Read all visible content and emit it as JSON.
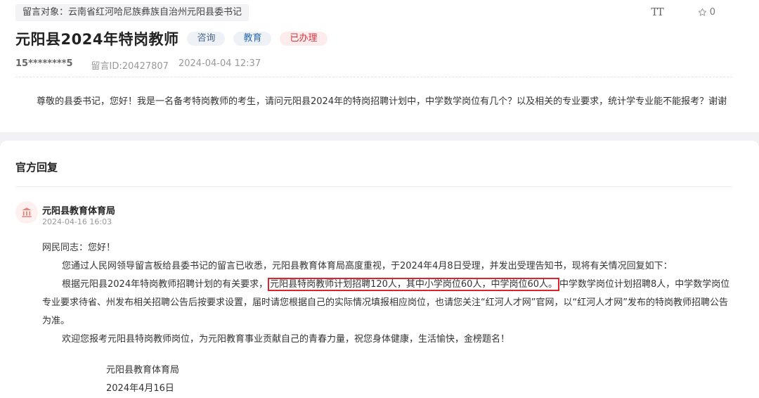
{
  "message": {
    "target": "留言对象：云南省红河哈尼族彝族自治州元阳县委书记",
    "title": "元阳县2024年特岗教师",
    "tags": [
      "咨询",
      "教育",
      "已办理"
    ],
    "user": "15********5",
    "message_id": "留言ID:20427807",
    "datetime": "2024-04-04 12:37",
    "star_count": "0",
    "question": "尊敬的县委书记，您好！我是一名备考特岗教师的考生，请问元阳县2024年的特岗招聘计划中，中学数学岗位有几个？以及相关的专业要求，统计学专业能不能报考？谢谢"
  },
  "reply": {
    "section_title": "官方回复",
    "department": "元阳县教育体育局",
    "datetime": "2024-04-16 16:03",
    "greeting": "网民同志：您好！",
    "para1": "您通过人民网领导留言板给县委书记的留言已收悉，元阳县教育体育局高度重视，于2024年4月8日受理，并发出受理告知书，现将有关情况回复如下：",
    "para2_pre": "根据元阳县2024年特岗教师招聘计划的有关要求，",
    "para2_highlight": "元阳县特岗教师计划招聘120人，其中小学岗位60人，中学岗位60人。",
    "para2_post": "中学数学岗位计划招聘8人，中学数学岗位专业要求待省、州发布相关招聘公告后按要求设置，届时请您根据自己的实际情况填报相应岗位，也请您关注“红河人才网”官网，以“红河人才网”发布的特岗教师招聘公告为准。",
    "para3": "欢迎您报考元阳县特岗教师岗位，为元阳教育事业贡献自己的青春力量，祝您身体健康，生活愉快，金榜题名！",
    "sign_dept": "元阳县教育体育局",
    "sign_date": "2024年4月16日"
  },
  "icons": {
    "font_size": "font-size-icon",
    "star": "star-icon",
    "avatar": "government-building-icon"
  },
  "colors": {
    "highlight_border": "#d9252b",
    "done_tag": "#d9333f",
    "edu_tag": "#2b6cb0"
  }
}
